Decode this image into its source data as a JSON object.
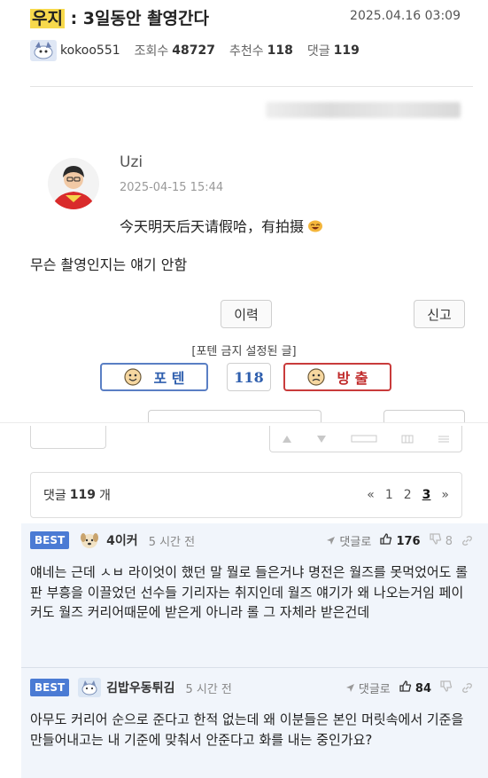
{
  "post": {
    "title_tag": "우지",
    "title_rest": " : 3일동안 촬영간다",
    "date": "2025.04.16 03:09",
    "author": "kokoo551",
    "views_label": "조회수",
    "views": "48727",
    "recommend_label": "추천수",
    "recommend": "118",
    "comments_label": "댓글",
    "comments": "119"
  },
  "weibo": {
    "name": "Uzi",
    "time": "2025-04-15 15:44",
    "text": "今天明天后天请假哈，有拍摄"
  },
  "body_text": "무슨 촬영인지는 얘기 안함",
  "buttons": {
    "history": "이력",
    "report": "신고",
    "potten_notice": "[포텐 금지 설정된 글]",
    "vote_up": "포 텐",
    "vote_count": "118",
    "vote_down": "방 출"
  },
  "comment_bar": {
    "label": "댓글",
    "count": "119",
    "unit": "개",
    "prev": "«",
    "pages": [
      "1",
      "2",
      "3"
    ],
    "current_page": "3",
    "next": "»"
  },
  "best_comments": [
    {
      "badge": "BEST",
      "nick": "4이커",
      "time": "5 시간 전",
      "reply_label": "댓글로",
      "up": "176",
      "down": "8",
      "body": "얘네는 근데 ㅅㅂ 라이엇이 했던 말 뭘로 들은거냐 명전은 월즈를 못먹었어도 롤판 부흥을 이끌었던 선수들 기리자는 취지인데 월즈 얘기가 왜 나오는거임 페이커도 월즈 커리어때문에 받은게 아니라 롤 그 자체라 받은건데"
    },
    {
      "badge": "BEST",
      "nick": "김밥우동튀김",
      "time": "5 시간 전",
      "reply_label": "댓글로",
      "up": "84",
      "down": "",
      "body": "아무도 커리어 순으로 준다고 한적 없는데 왜 이분들은 본인 머릿속에서 기준을 만들어내고는 내 기준에 맞춰서 안준다고 화를 내는 중인가요?"
    }
  ],
  "colors": {
    "title_highlight": "#f7d94c",
    "best_badge": "#4b7bd4",
    "vote_up_border": "#5a7fc4",
    "vote_down_border": "#c93b3b",
    "best_bg": "#f1f5fb"
  }
}
